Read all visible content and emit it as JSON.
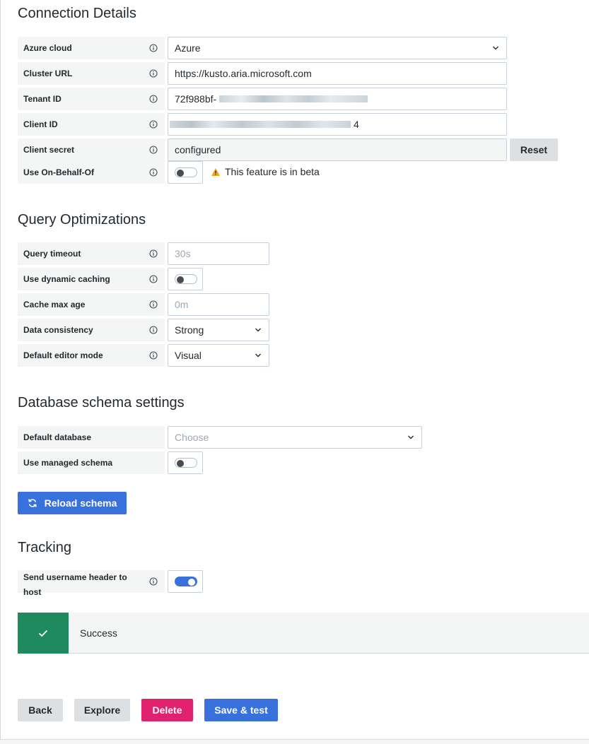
{
  "sections": {
    "connection": "Connection Details",
    "query": "Query Optimizations",
    "schema": "Database schema settings",
    "tracking": "Tracking"
  },
  "connection": {
    "azure_cloud": {
      "label": "Azure cloud",
      "value": "Azure"
    },
    "cluster_url": {
      "label": "Cluster URL",
      "value": "https://kusto.aria.microsoft.com"
    },
    "tenant_id": {
      "label": "Tenant ID",
      "value": "72f988bf-"
    },
    "client_id": {
      "label": "Client ID",
      "value": "4"
    },
    "client_secret": {
      "label": "Client secret",
      "value": "configured",
      "reset_label": "Reset"
    },
    "on_behalf_of": {
      "label": "Use On-Behalf-Of",
      "enabled": false,
      "beta_note": "This feature is in beta"
    }
  },
  "query": {
    "timeout": {
      "label": "Query timeout",
      "placeholder": "30s"
    },
    "dynamic_caching": {
      "label": "Use dynamic caching",
      "enabled": false
    },
    "cache_max_age": {
      "label": "Cache max age",
      "placeholder": "0m"
    },
    "data_consistency": {
      "label": "Data consistency",
      "value": "Strong"
    },
    "editor_mode": {
      "label": "Default editor mode",
      "value": "Visual"
    }
  },
  "schema": {
    "default_database": {
      "label": "Default database",
      "placeholder": "Choose"
    },
    "managed_schema": {
      "label": "Use managed schema",
      "enabled": false
    },
    "reload_label": "Reload schema"
  },
  "tracking": {
    "send_username": {
      "label_line1": "Send username header to",
      "label_line2": "host",
      "enabled": true
    }
  },
  "alert": {
    "text": "Success",
    "color": "#1f8a5e"
  },
  "footer": {
    "back": "Back",
    "explore": "Explore",
    "delete": "Delete",
    "save_test": "Save & test"
  },
  "colors": {
    "primary": "#3871dc",
    "danger": "#e0226e",
    "success": "#1f8a5e",
    "label_bg": "#f4f5f5"
  }
}
